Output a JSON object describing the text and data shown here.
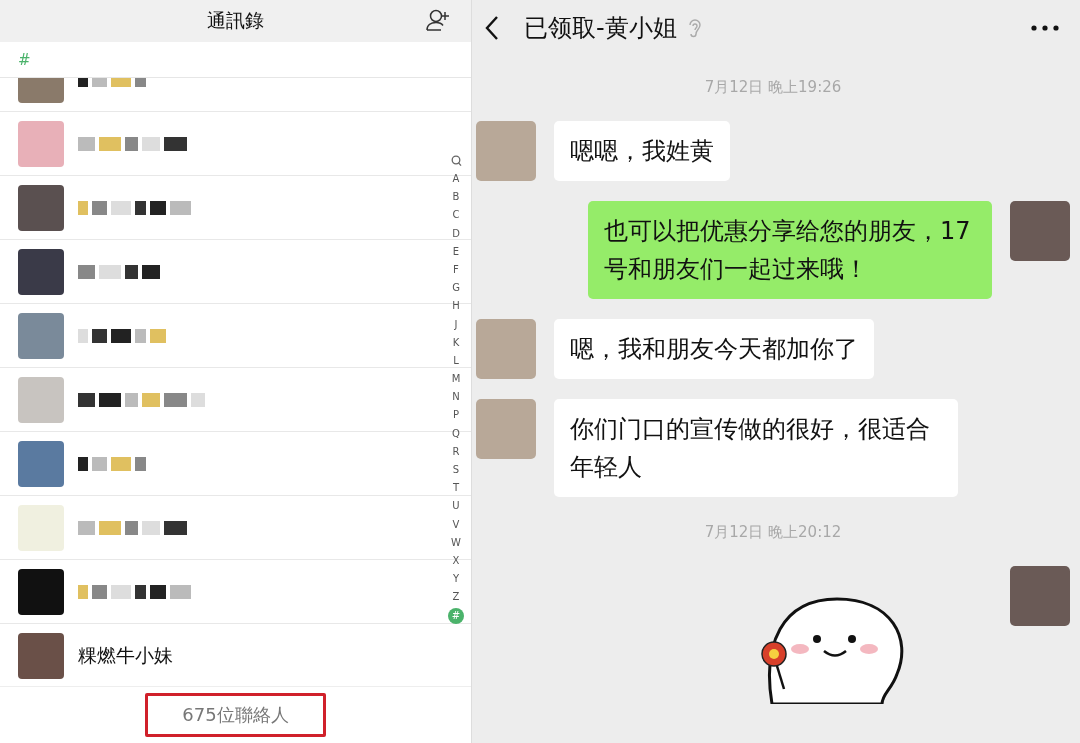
{
  "contacts_panel": {
    "title": "通訊錄",
    "section_header": "#",
    "contacts": [
      {
        "kind": "blurred"
      },
      {
        "kind": "blurred"
      },
      {
        "kind": "blurred"
      },
      {
        "kind": "blurred"
      },
      {
        "kind": "blurred"
      },
      {
        "kind": "blurred"
      },
      {
        "kind": "blurred"
      },
      {
        "kind": "blurred"
      },
      {
        "kind": "blurred"
      },
      {
        "kind": "named",
        "name": "粿燃牛小妹"
      }
    ],
    "index_letters": [
      {
        "label": "A",
        "selected": false
      },
      {
        "label": "B",
        "selected": false
      },
      {
        "label": "C",
        "selected": false
      },
      {
        "label": "D",
        "selected": false
      },
      {
        "label": "E",
        "selected": false
      },
      {
        "label": "F",
        "selected": false
      },
      {
        "label": "G",
        "selected": false
      },
      {
        "label": "H",
        "selected": false
      },
      {
        "label": "J",
        "selected": false
      },
      {
        "label": "K",
        "selected": false
      },
      {
        "label": "L",
        "selected": false
      },
      {
        "label": "M",
        "selected": false
      },
      {
        "label": "N",
        "selected": false
      },
      {
        "label": "P",
        "selected": false
      },
      {
        "label": "Q",
        "selected": false
      },
      {
        "label": "R",
        "selected": false
      },
      {
        "label": "S",
        "selected": false
      },
      {
        "label": "T",
        "selected": false
      },
      {
        "label": "U",
        "selected": false
      },
      {
        "label": "V",
        "selected": false
      },
      {
        "label": "W",
        "selected": false
      },
      {
        "label": "X",
        "selected": false
      },
      {
        "label": "Y",
        "selected": false
      },
      {
        "label": "Z",
        "selected": false
      },
      {
        "label": "#",
        "selected": true
      }
    ],
    "contact_count": "675位聯絡人"
  },
  "chat": {
    "title": "已领取-黄小姐",
    "messages": [
      {
        "kind": "time",
        "text": "7月12日 晚上19:26"
      },
      {
        "kind": "incoming",
        "text": "嗯嗯，我姓黄"
      },
      {
        "kind": "outgoing",
        "text": "也可以把优惠分享给您的朋友，17号和朋友们一起过来哦！"
      },
      {
        "kind": "incoming",
        "text": "嗯，我和朋友今天都加你了"
      },
      {
        "kind": "incoming",
        "text": "你们门口的宣传做的很好，很适合年轻人"
      },
      {
        "kind": "time",
        "text": "7月12日 晚上20:12"
      },
      {
        "kind": "sticker"
      }
    ]
  }
}
